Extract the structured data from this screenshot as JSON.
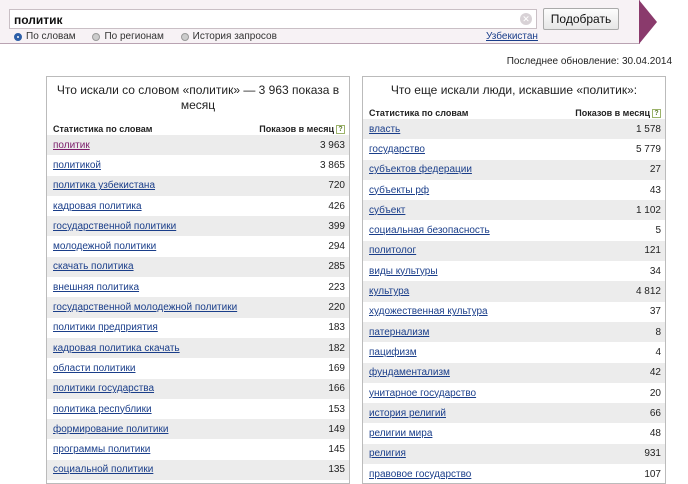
{
  "search": {
    "query": "политик",
    "submit_label": "Подобрать",
    "modes": [
      {
        "label": "По словам",
        "selected": true
      },
      {
        "label": "По регионам",
        "selected": false
      },
      {
        "label": "История запросов",
        "selected": false
      }
    ],
    "region": "Узбекистан"
  },
  "last_update": "Последнее обновление: 30.04.2014",
  "left_panel": {
    "title": "Что искали со словом «политик» — 3 963 показа в месяц",
    "col_stats": "Статистика по словам",
    "col_shows": "Показов в месяц",
    "rows": [
      {
        "phrase": "политик",
        "count": "3 963"
      },
      {
        "phrase": "политикой",
        "count": "3 865"
      },
      {
        "phrase": "политика узбекистана",
        "count": "720"
      },
      {
        "phrase": "кадровая политика",
        "count": "426"
      },
      {
        "phrase": "государственной политики",
        "count": "399"
      },
      {
        "phrase": "молодежной политики",
        "count": "294"
      },
      {
        "phrase": "скачать политика",
        "count": "285"
      },
      {
        "phrase": "внешняя политика",
        "count": "223"
      },
      {
        "phrase": "государственной молодежной политики",
        "count": "220"
      },
      {
        "phrase": "политики предприятия",
        "count": "183"
      },
      {
        "phrase": "кадровая политика скачать",
        "count": "182"
      },
      {
        "phrase": "области политики",
        "count": "169"
      },
      {
        "phrase": "политики государства",
        "count": "166"
      },
      {
        "phrase": "политика республики",
        "count": "153"
      },
      {
        "phrase": "формирование политики",
        "count": "149"
      },
      {
        "phrase": "программы политики",
        "count": "145"
      },
      {
        "phrase": "социальной политики",
        "count": "135"
      }
    ]
  },
  "right_panel": {
    "title": "Что еще искали люди, искавшие «политик»:",
    "col_stats": "Статистика по словам",
    "col_shows": "Показов в месяц",
    "rows": [
      {
        "phrase": "власть",
        "count": "1 578"
      },
      {
        "phrase": "государство",
        "count": "5 779"
      },
      {
        "phrase": "субъектов федерации",
        "count": "27"
      },
      {
        "phrase": "субъекты рф",
        "count": "43"
      },
      {
        "phrase": "субъект",
        "count": "1 102"
      },
      {
        "phrase": "социальная безопасность",
        "count": "5"
      },
      {
        "phrase": "политолог",
        "count": "121"
      },
      {
        "phrase": "виды культуры",
        "count": "34"
      },
      {
        "phrase": "культура",
        "count": "4 812"
      },
      {
        "phrase": "художественная культура",
        "count": "37"
      },
      {
        "phrase": "патернализм",
        "count": "8"
      },
      {
        "phrase": "пацифизм",
        "count": "4"
      },
      {
        "phrase": "фундаментализм",
        "count": "42"
      },
      {
        "phrase": "унитарное государство",
        "count": "20"
      },
      {
        "phrase": "история религий",
        "count": "66"
      },
      {
        "phrase": "религии мира",
        "count": "48"
      },
      {
        "phrase": "религия",
        "count": "931"
      },
      {
        "phrase": "правовое государство",
        "count": "107"
      }
    ]
  }
}
